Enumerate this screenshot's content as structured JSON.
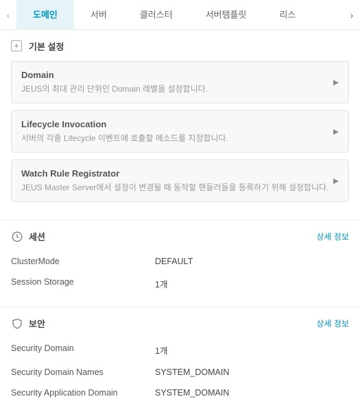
{
  "tabs": {
    "items": [
      "도메인",
      "서버",
      "클러스터",
      "서버탬플릿",
      "리스"
    ],
    "activeIndex": 0
  },
  "basic": {
    "title": "기본 설정",
    "cards": [
      {
        "title": "Domain",
        "desc": "JEUS의 최대 관리 단위인 Domain 레벨을 설정합니다."
      },
      {
        "title": "Lifecycle Invocation",
        "desc": "서버의 각종 Lifecycle 이벤트에 호출할 메소드를 지정합니다."
      },
      {
        "title": "Watch Rule Registrator",
        "desc": "JEUS Master Server에서 설정이 변경될 때 동작할 핸들러들을 등록하기 위해 설정합니다."
      }
    ]
  },
  "session": {
    "title": "세션",
    "detail": "상세 정보",
    "rows": [
      {
        "k": "ClusterMode",
        "v": "DEFAULT"
      },
      {
        "k": "Session Storage",
        "v": "1개"
      }
    ]
  },
  "security": {
    "title": "보안",
    "detail": "상세 정보",
    "rows": [
      {
        "k": "Security Domain",
        "v": "1개"
      },
      {
        "k": "Security Domain Names",
        "v": "SYSTEM_DOMAIN"
      },
      {
        "k": "Security Application Domain",
        "v": "SYSTEM_DOMAIN"
      }
    ]
  }
}
